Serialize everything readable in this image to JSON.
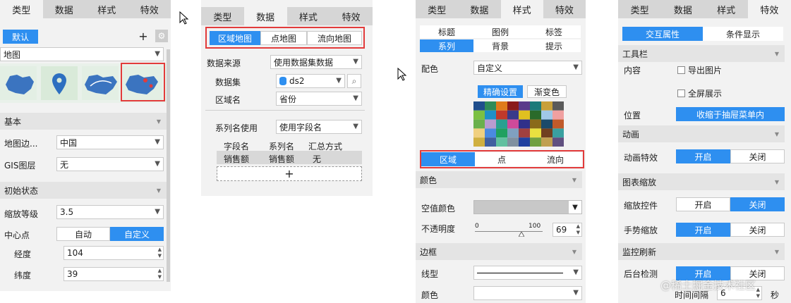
{
  "p1": {
    "tabs": [
      "类型",
      "数据",
      "样式",
      "特效"
    ],
    "default_label": "默认",
    "type_value": "地图",
    "sec_basic": "基本",
    "boundary_label": "地图边...",
    "boundary_value": "中国",
    "gis_label": "GIS图层",
    "gis_value": "无",
    "sec_init": "初始状态",
    "zoom_label": "缩放等级",
    "zoom_value": "3.5",
    "center_label": "中心点",
    "center_auto": "自动",
    "center_custom": "自定义",
    "lng_label": "经度",
    "lng_value": "104",
    "lat_label": "纬度",
    "lat_value": "39"
  },
  "p2": {
    "tabs": [
      "类型",
      "数据",
      "样式",
      "特效"
    ],
    "subtabs": [
      "区域地图",
      "点地图",
      "流向地图"
    ],
    "source_label": "数据来源",
    "source_value": "使用数据集数据",
    "dataset_label": "数据集",
    "dataset_value": "ds2",
    "area_label": "区域名",
    "area_value": "省份",
    "series_label": "系列名使用",
    "series_value": "使用字段名",
    "col_headers": [
      "字段名",
      "系列名",
      "汇总方式"
    ],
    "row": [
      "销售额",
      "销售额",
      "无"
    ],
    "add_symbol": "+"
  },
  "p3": {
    "tabs": [
      "类型",
      "数据",
      "样式",
      "特效"
    ],
    "style_tabs_row1": [
      "标题",
      "图例",
      "标签"
    ],
    "style_tabs_row2": [
      "系列",
      "背景",
      "提示"
    ],
    "color_label": "配色",
    "color_value": "自定义",
    "fine_btn": "精确设置",
    "grad_btn": "渐变色",
    "palette": [
      "#1f4e8c",
      "#2e8b57",
      "#e07b1a",
      "#8a1a1a",
      "#5a3a8a",
      "#1a7a7a",
      "#c8a03a",
      "#5a5a5a",
      "#7bc043",
      "#1e90c8",
      "#c0392b",
      "#3a3a8a",
      "#e0c020",
      "#2a6a2a",
      "#a0c8e8",
      "#f0a0a0",
      "#6ab04c",
      "#b89cd0",
      "#2aa090",
      "#d04a9a",
      "#30308a",
      "#8a6a1a",
      "#1a4a6a",
      "#c05a2a",
      "#f0d080",
      "#4a8ae0",
      "#20a060",
      "#80a0c0",
      "#a04040",
      "#e8e040",
      "#704020",
      "#3aa0a0",
      "#d0b040",
      "#4060a0",
      "#60c0a0",
      "#8090a0",
      "#2040a0",
      "#70a040",
      "#c0a050",
      "#605080"
    ],
    "sub_tabs": [
      "区域",
      "点",
      "流向"
    ],
    "sec_color": "颜色",
    "null_color_label": "空值颜色",
    "opacity_label": "不透明度",
    "opacity_min": "0",
    "opacity_max": "100",
    "opacity_value": "69",
    "opacity_level": 0.69,
    "sec_border": "边框",
    "line_label": "线型",
    "border_color_label": "颜色"
  },
  "p4": {
    "tabs": [
      "类型",
      "数据",
      "样式",
      "特效"
    ],
    "subtabs": [
      "交互属性",
      "条件显示"
    ],
    "sec_toolbar": "工具栏",
    "content_label": "内容",
    "export_label": "导出图片",
    "fullscreen_label": "全屏展示",
    "pos_label": "位置",
    "pos_value": "收缩于抽屉菜单内",
    "sec_anim": "动画",
    "anim_label": "动画特效",
    "on": "开启",
    "off": "关闭",
    "sec_zoom": "图表缩放",
    "zoom_ctrl_label": "缩放控件",
    "gesture_label": "手势缩放",
    "sec_monitor": "监控刷新",
    "bg_label": "后台检测",
    "interval_label": "时间间隔",
    "interval_value": "6",
    "sec_unit": "秒",
    "watermark": "@稀土掘金技术社区"
  },
  "colors": {
    "accent": "#2e8ff0",
    "highlight": "#e23b3b",
    "panel": "#f2f2f2",
    "tab": "#d6d6d6"
  }
}
